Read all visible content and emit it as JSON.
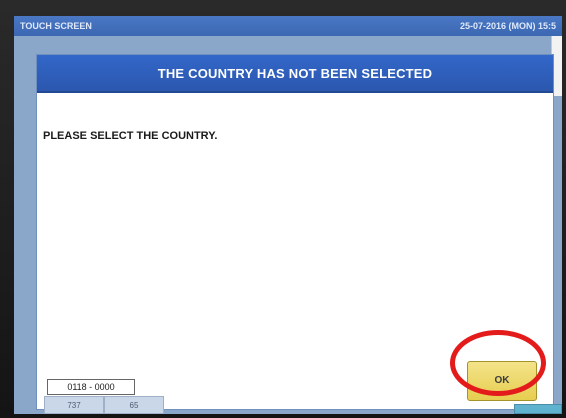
{
  "topbar": {
    "title": "TOUCH SCREEN",
    "datetime": "25-07-2016 (MON) 15:5"
  },
  "dialog": {
    "header": "THE COUNTRY HAS NOT BEEN SELECTED",
    "message": "PLEASE SELECT THE COUNTRY.",
    "code": "0118 - 0000",
    "ok_label": "OK"
  },
  "bottom": {
    "tabs": [
      "737",
      "65"
    ]
  },
  "colors": {
    "header_blue": "#2b57ae",
    "ok_yellow": "#e6ce4f",
    "annotation_red": "#e31b1b"
  }
}
